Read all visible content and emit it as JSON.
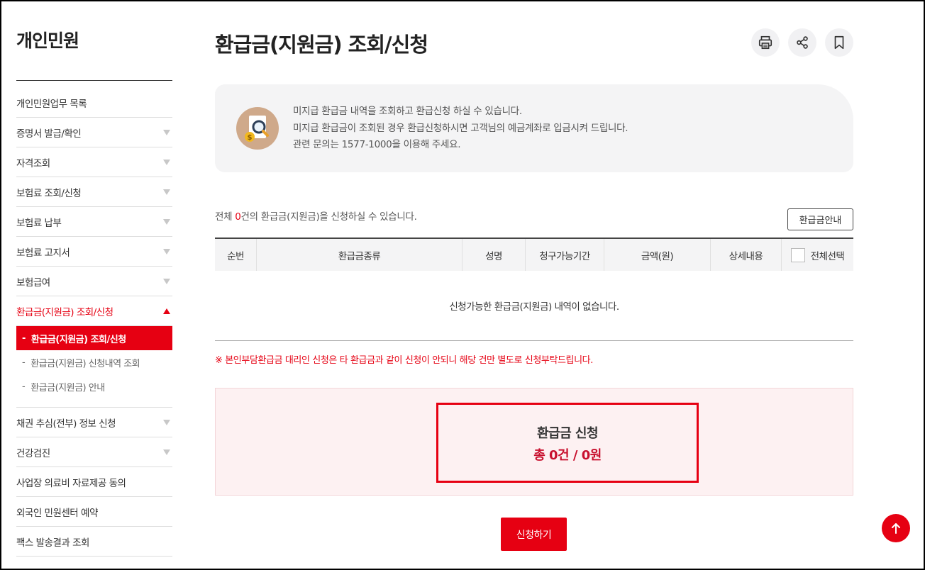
{
  "sidebar": {
    "title": "개인민원",
    "items": [
      {
        "label": "개인민원업무 목록"
      },
      {
        "label": "증명서 발급/확인"
      },
      {
        "label": "자격조회"
      },
      {
        "label": "보험료 조회/신청"
      },
      {
        "label": "보험료 납부"
      },
      {
        "label": "보험료 고지서"
      },
      {
        "label": "보험급여"
      },
      {
        "label": "환급금(지원금) 조회/신청"
      },
      {
        "label": "채권 추심(전부) 정보 신청"
      },
      {
        "label": "건강검진"
      },
      {
        "label": "사업장 의료비 자료제공 동의"
      },
      {
        "label": "외국인 민원센터 예약"
      },
      {
        "label": "팩스 발송결과 조회"
      }
    ],
    "sub_items": [
      {
        "label": "환급금(지원금) 조회/신청"
      },
      {
        "label": "환급금(지원금) 신청내역 조회"
      },
      {
        "label": "환급금(지원금) 안내"
      }
    ],
    "dash": "-"
  },
  "header": {
    "title": "환급금(지원금) 조회/신청",
    "icons": [
      "print-icon",
      "share-icon",
      "bookmark-icon"
    ]
  },
  "info": {
    "line1": "미지급 환급금 내역을 조회하고 환급신청 하실 수 있습니다.",
    "line2": "미지급 환급금이 조회된 경우 환급신청하시면 고객님의 예금계좌로 입금시켜 드립니다.",
    "line3": "관련 문의는 1577-1000을 이용해 주세요."
  },
  "count": {
    "prefix": "전체 ",
    "num": "0",
    "suffix": "건의 환급금(지원금)을 신청하실 수 있습니다."
  },
  "guide_button": "환급금안내",
  "table": {
    "headers": [
      "순번",
      "환급금종류",
      "성명",
      "청구가능기간",
      "금액(원)",
      "상세내용",
      "전체선택"
    ],
    "empty_message": "신청가능한 환급금(지원금) 내역이 없습니다."
  },
  "notice": "※ 본인부담환급금 대리인 신청은 타 환급금과 같이 신청이 안되니 해당 건만 별도로 신청부탁드립니다.",
  "summary": {
    "title": "환급금 신청",
    "value": "총 0건 / 0원"
  },
  "apply_button": "신청하기",
  "colors": {
    "accent": "#e60012",
    "summary_bg": "#fdf1f2",
    "info_bg": "#f4f4f5"
  }
}
